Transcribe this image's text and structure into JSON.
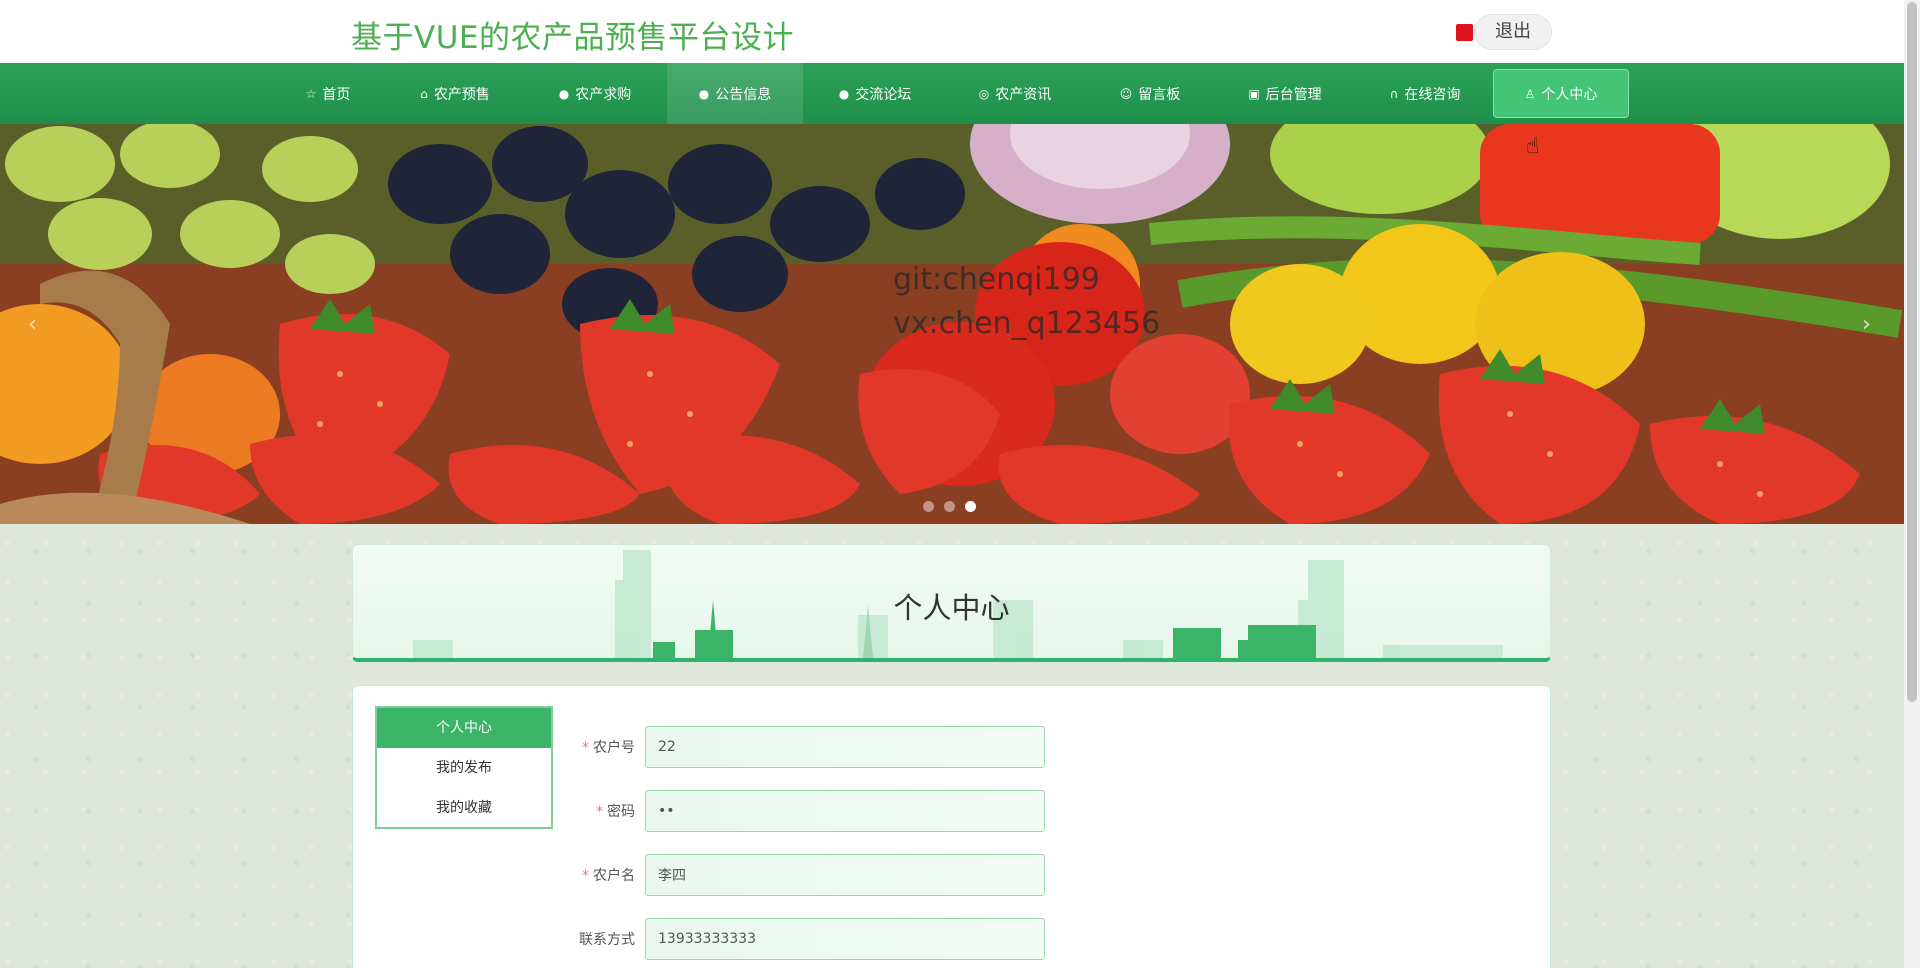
{
  "header": {
    "site_title": "基于VUE的农产品预售平台设计",
    "logout_label": "退出"
  },
  "nav": {
    "items": [
      {
        "label": "首页",
        "icon": "☆"
      },
      {
        "label": "农产预售",
        "icon": "⌂"
      },
      {
        "label": "农产求购",
        "icon": "●"
      },
      {
        "label": "公告信息",
        "icon": "●"
      },
      {
        "label": "交流论坛",
        "icon": "●"
      },
      {
        "label": "农产资讯",
        "icon": "◎"
      },
      {
        "label": "留言板",
        "icon": "☺"
      },
      {
        "label": "后台管理",
        "icon": "▣"
      },
      {
        "label": "在线咨询",
        "icon": "∩"
      },
      {
        "label": "个人中心",
        "icon": "♙"
      }
    ]
  },
  "banner": {
    "watermark_line1": "git:chenqi199",
    "watermark_line2": "vx:chen_q123456",
    "prev_arrow": "‹",
    "next_arrow": "›",
    "active_slide": 3,
    "slide_count": 3
  },
  "section": {
    "title": "个人中心"
  },
  "side_menu": {
    "items": [
      "个人中心",
      "我的发布",
      "我的收藏"
    ]
  },
  "form": {
    "fields": [
      {
        "label": "农户号",
        "value": "22",
        "required": true
      },
      {
        "label": "密码",
        "value": "••",
        "required": true
      },
      {
        "label": "农户名",
        "value": "李四",
        "required": true
      },
      {
        "label": "联系方式",
        "value": "13933333333",
        "required": false
      }
    ]
  },
  "colors": {
    "brand_green": "#2da15a",
    "title_green": "#4caf50",
    "active_green": "#43c476"
  }
}
